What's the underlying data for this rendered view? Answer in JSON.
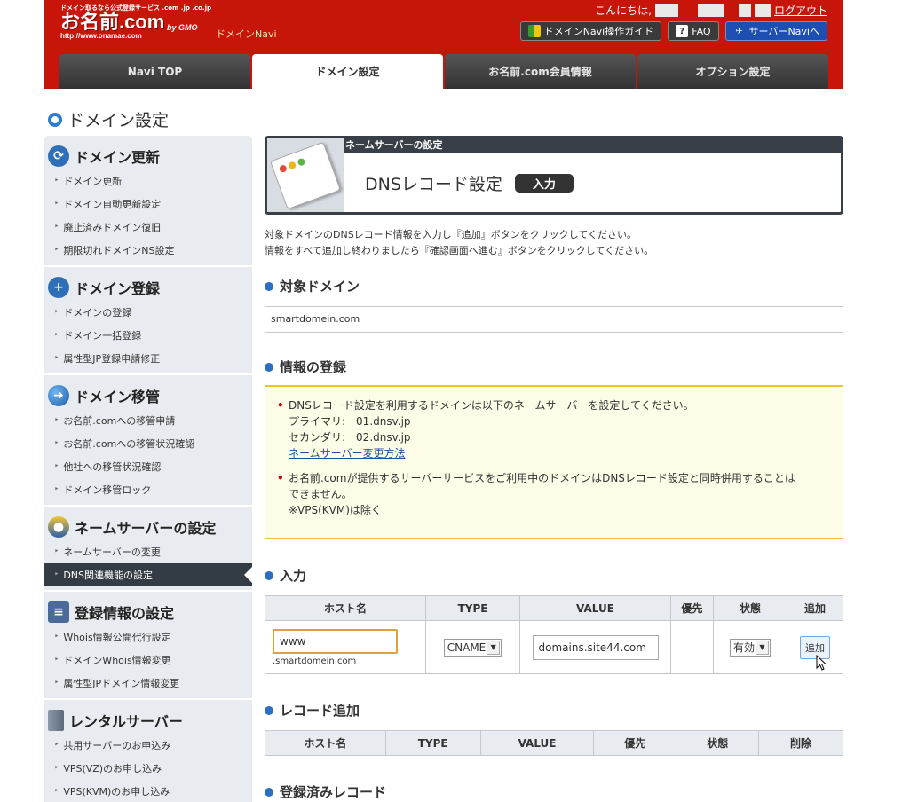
{
  "header": {
    "logo_top": "ドメイン取るなら公式登録サービス .com .jp .co.jp",
    "logo_main": "お名前.com",
    "logo_url": "http://www.onamae.com",
    "logo_gmo": "by GMO",
    "navi_label": "ドメインNavi",
    "greeting": "こんにちは,",
    "logout": "ログアウト",
    "buttons": {
      "guide": "ドメインNavi操作ガイド",
      "faq": "FAQ",
      "server": "サーバーNaviへ"
    },
    "tabs": [
      "Navi TOP",
      "ドメイン設定",
      "お名前.com会員情報",
      "オプション設定"
    ]
  },
  "page_title": "ドメイン設定",
  "sidebar": {
    "sections": [
      {
        "title": "ドメイン更新",
        "icon": "refresh-icon",
        "items": [
          "ドメイン更新",
          "ドメイン自動更新設定",
          "廃止済みドメイン復旧",
          "期限切れドメインNS設定"
        ]
      },
      {
        "title": "ドメイン登録",
        "icon": "plus-icon",
        "items": [
          "ドメインの登録",
          "ドメイン一括登録",
          "属性型JP登録申請修正"
        ]
      },
      {
        "title": "ドメイン移管",
        "icon": "globe-icon",
        "items": [
          "お名前.comへの移管申請",
          "お名前.comへの移管状況確認",
          "他社への移管状況確認",
          "ドメイン移管ロック"
        ]
      },
      {
        "title": "ネームサーバーの設定",
        "icon": "users-icon",
        "items": [
          "ネームサーバーの変更",
          "DNS関連機能の設定"
        ]
      },
      {
        "title": "登録情報の設定",
        "icon": "document-icon",
        "items": [
          "Whois情報公開代行設定",
          "ドメインWhois情報変更",
          "属性型JPドメイン情報変更"
        ]
      },
      {
        "title": "レンタルサーバー",
        "icon": "server-icon",
        "items": [
          "共用サーバーのお申込み",
          "VPS(VZ)のお申し込み",
          "VPS(KVM)のお申し込み"
        ]
      }
    ]
  },
  "banner": {
    "strip": "ネームサーバーの設定",
    "title": "DNSレコード設定",
    "badge": "入力"
  },
  "instructions": {
    "line1": "対象ドメインのDNSレコード情報を入力し『追加』ボタンをクリックしてください。",
    "line2": "情報をすべて追加し終わりましたら『確認画面へ進む』ボタンをクリックしてください。"
  },
  "target_domain": {
    "title": "対象ドメイン",
    "value": "smartdomein.com"
  },
  "info": {
    "title": "情報の登録",
    "item1_line1": "DNSレコード設定を利用するドメインは以下のネームサーバーを設定してください。",
    "item1_primary": "プライマリ:　01.dnsv.jp",
    "item1_secondary": "セカンダリ:　02.dnsv.jp",
    "item1_link": "ネームサーバー変更方法",
    "item2_line1": "お名前.comが提供するサーバーサービスをご利用中のドメインはDNSレコード設定と同時併用することは",
    "item2_line2": "できません。",
    "item2_line3": "※VPS(KVM)は除く"
  },
  "input_section": {
    "title": "入力",
    "headers": [
      "ホスト名",
      "TYPE",
      "VALUE",
      "優先",
      "状態",
      "追加"
    ],
    "host_value": "www",
    "host_suffix": ".smartdomein.com",
    "type_value": "CNAME",
    "value_value": "domains.site44.com",
    "status_value": "有効",
    "add_label": "追加"
  },
  "record_add": {
    "title": "レコード追加",
    "headers": [
      "ホスト名",
      "TYPE",
      "VALUE",
      "優先",
      "状態",
      "削除"
    ]
  },
  "registered": {
    "title": "登録済みレコード"
  }
}
